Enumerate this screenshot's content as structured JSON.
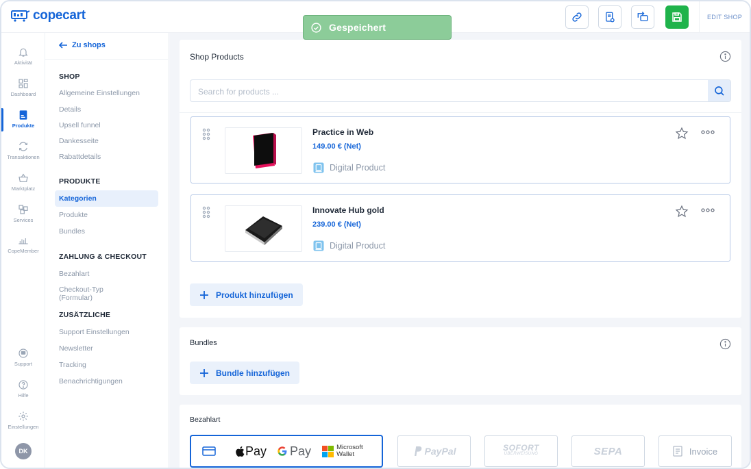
{
  "app": {
    "logo_text": "copecart"
  },
  "toast": {
    "text": "Gespeichert"
  },
  "toolbar": {
    "edit_shop_label": "EDIT SHOP"
  },
  "rail": {
    "items": [
      {
        "label": "Aktivität",
        "icon": "bell-icon"
      },
      {
        "label": "Dashboard",
        "icon": "dashboard-icon"
      },
      {
        "label": "Produkte",
        "icon": "product-icon",
        "active": true
      },
      {
        "label": "Transaktionen",
        "icon": "transactions-icon"
      },
      {
        "label": "Marktplatz",
        "icon": "basket-icon"
      },
      {
        "label": "Services",
        "icon": "services-icon"
      },
      {
        "label": "CopeMember",
        "icon": "copemember-icon"
      },
      {
        "label": "Support",
        "icon": "support-icon"
      },
      {
        "label": "Hilfe",
        "icon": "help-icon"
      },
      {
        "label": "Einstellungen",
        "icon": "gear-icon"
      }
    ],
    "avatar": "DK"
  },
  "sidebar": {
    "back_label": "Zu shops",
    "sections": [
      {
        "heading": "SHOP",
        "items": [
          "Allgemeine Einstellungen",
          "Details",
          "Upsell funnel",
          "Dankesseite",
          "Rabattdetails"
        ]
      },
      {
        "heading": "PRODUKTE",
        "items": [
          "Kategorien",
          "Produkte",
          "Bundles"
        ],
        "active": "Kategorien"
      },
      {
        "heading": "ZAHLUNG & CHECKOUT",
        "items": [
          "Bezahlart",
          "Checkout-Typ",
          "(Formular)"
        ]
      },
      {
        "heading": "ZUSÄTZLICHE",
        "items": [
          "Support Einstellungen",
          "Newsletter",
          "Tracking",
          "Benachrichtigungen"
        ]
      }
    ]
  },
  "products_card": {
    "title": "Shop Products",
    "search_placeholder": "Search for products ...",
    "products": [
      {
        "name": "Practice in Web",
        "price": "149.00 €  (Net)",
        "type": "Digital Product"
      },
      {
        "name": "Innovate Hub gold",
        "price": "239.00 €  (Net)",
        "type": "Digital Product"
      }
    ],
    "add_label": "Produkt hinzufügen"
  },
  "bundles_card": {
    "title": "Bundles",
    "add_label": "Bundle hinzufügen"
  },
  "payment_card": {
    "title": "Bezahlart",
    "group": {
      "apple": "Pay",
      "google": "Pay",
      "microsoft_line1": "Microsoft",
      "microsoft_line2": "Wallet"
    },
    "options": [
      "PayPal",
      "SOFORT",
      "ÜBERWEISUNG",
      "SEPA",
      "Invoice"
    ]
  },
  "colors": {
    "accent": "#1565d8",
    "save_green": "#1fb34b",
    "toast_green": "#8ccc99"
  }
}
